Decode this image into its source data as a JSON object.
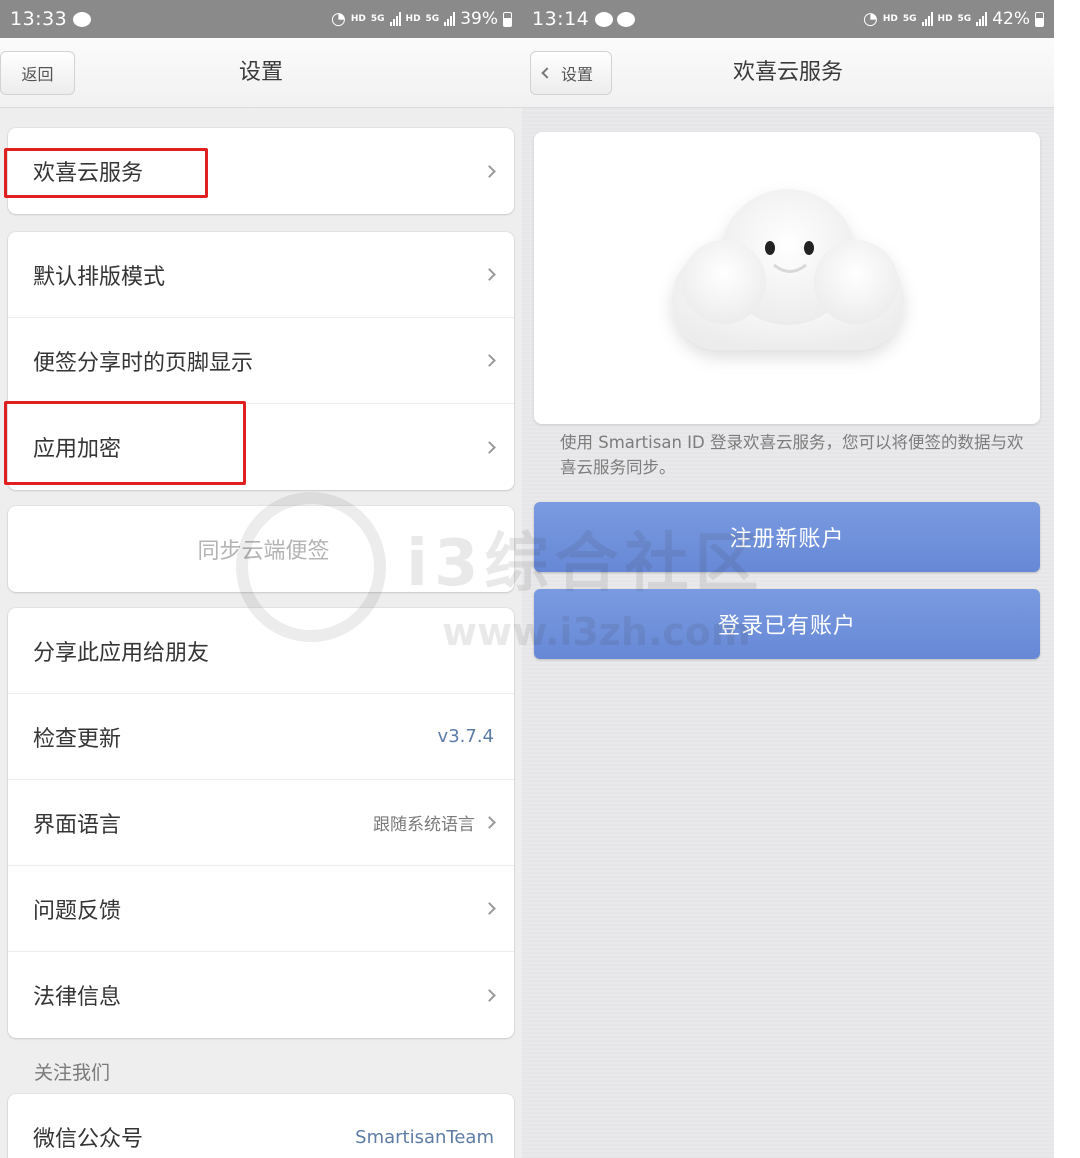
{
  "left": {
    "status": {
      "time": "13:33",
      "battery": "39%",
      "hd": "HD",
      "net": "5G"
    },
    "nav": {
      "back": "返回",
      "title": "设置"
    },
    "card1": [
      "欢喜云服务"
    ],
    "card2": [
      "默认排版模式",
      "便签分享时的页脚显示",
      "应用加密"
    ],
    "sync_button": "同步云端便签",
    "card3": {
      "share": "分享此应用给朋友",
      "update": {
        "label": "检查更新",
        "value": "v3.7.4"
      },
      "language": {
        "label": "界面语言",
        "value": "跟随系统语言"
      },
      "feedback": "问题反馈",
      "legal": "法律信息"
    },
    "follow_section": "关注我们",
    "wechat": {
      "label": "微信公众号",
      "value": "SmartisanTeam"
    }
  },
  "right": {
    "status": {
      "time": "13:14",
      "battery": "42%",
      "hd": "HD",
      "net": "5G"
    },
    "nav": {
      "back": "设置",
      "title": "欢喜云服务"
    },
    "description": "使用 Smartisan ID 登录欢喜云服务，您可以将便签的数据与欢喜云服务同步。",
    "register": "注册新账户",
    "login": "登录已有账户"
  },
  "watermark": {
    "text": "i3综合社区",
    "url": "www.i3zh.com"
  },
  "colors": {
    "highlight": "#e02020",
    "primary_button": "#6f8fdb",
    "link_value": "#5d7ca6"
  }
}
